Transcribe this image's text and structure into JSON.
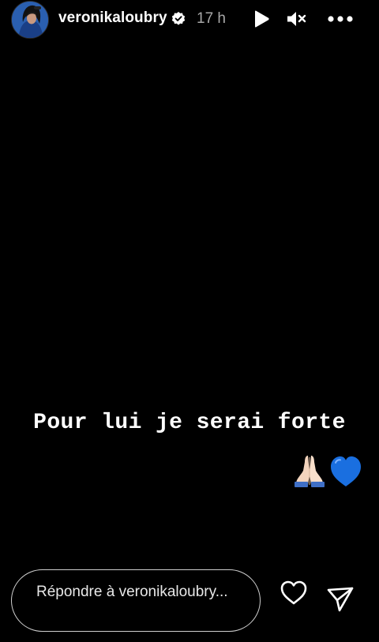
{
  "header": {
    "username": "veronikaloubry",
    "timestamp": "17 h",
    "verified_icon": "verified-badge-icon",
    "play_icon": "play-icon",
    "mute_icon": "muted-speaker-icon",
    "more_icon": "more-horizontal-icon"
  },
  "story": {
    "text": "Pour lui je serai forte",
    "emojis": [
      "folded-hands",
      "blue-heart"
    ]
  },
  "footer": {
    "reply_placeholder": "Répondre à veronikaloubry...",
    "like_icon": "heart-outline-icon",
    "send_icon": "paper-plane-icon"
  },
  "colors": {
    "background": "#000000",
    "text": "#ffffff",
    "timestamp": "#a8a8a8",
    "blue_heart": "#1a6fe0"
  }
}
